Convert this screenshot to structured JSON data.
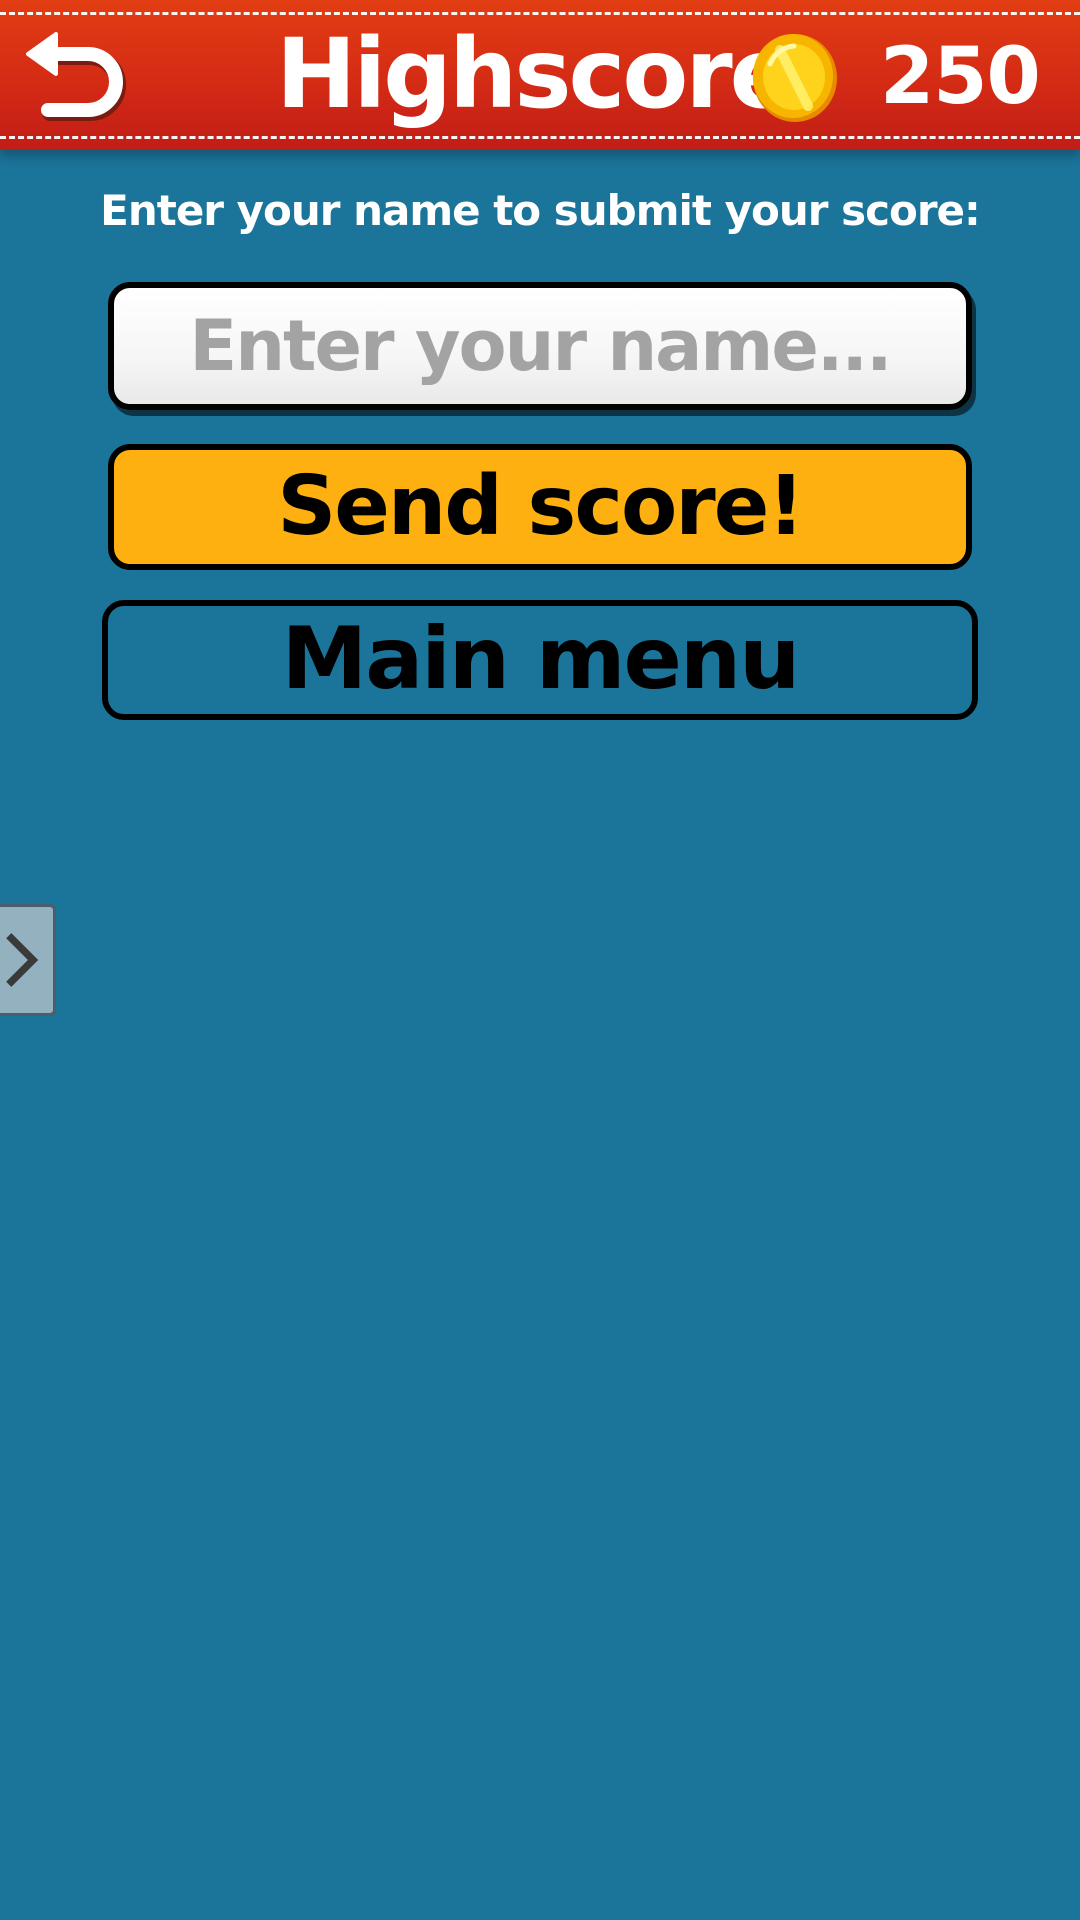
{
  "header": {
    "title": "Highscore",
    "coin_count": "250",
    "back_icon": "back-arrow-icon",
    "coin_icon": "gold-coin-icon",
    "colors": {
      "bar": "#d42b15",
      "text": "#ffffff"
    }
  },
  "form": {
    "prompt": "Enter your name to submit your score:",
    "name_input": {
      "placeholder": "Enter your name...",
      "value": ""
    },
    "send_label": "Send score!",
    "menu_label": "Main menu",
    "colors": {
      "send_button": "#ffb011",
      "background": "#1b7499"
    }
  },
  "side_tab": {
    "icon": "chevron-right-icon"
  }
}
